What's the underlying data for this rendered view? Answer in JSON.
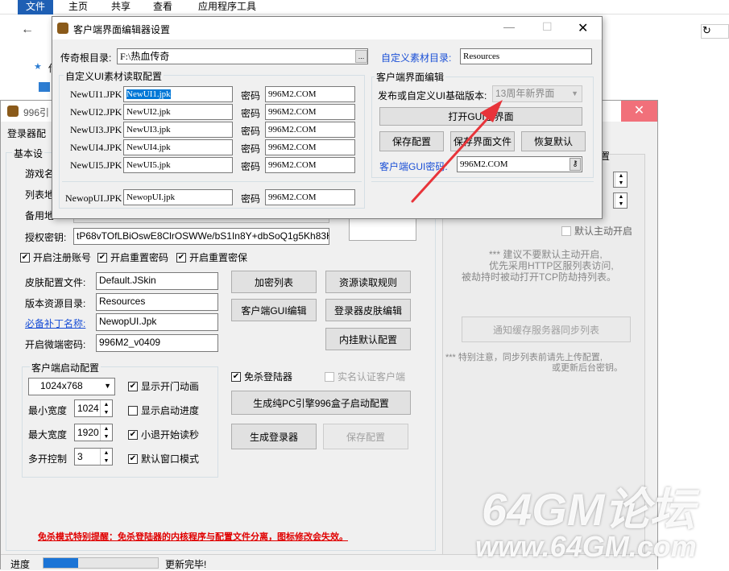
{
  "explorer": {
    "tabs": [
      "文件",
      "主页",
      "共享",
      "查看",
      "应用程序工具"
    ],
    "side_fragment": "传"
  },
  "launcher": {
    "title_fragment": "996引",
    "menu_fragment": "登录器配",
    "basic_settings": "基本设",
    "row_labels": [
      "游戏名",
      "列表地",
      "备用地"
    ],
    "auth_label": "授权密钥:",
    "auth_value": "tP68vTOfLBiOswE8ClrOSWWe/bS1In8Y+dbSoQ1g5Kh83Hsd",
    "checks": [
      "开启注册账号",
      "开启重置密码",
      "开启重置密保"
    ],
    "skin_label": "皮肤配置文件:",
    "skin_value": "Default.JSkin",
    "version_label": "版本资源目录:",
    "version_value": "Resources",
    "patch_label": "必备补丁名称:",
    "patch_value": "NewopUI.Jpk",
    "micro_label": "开启微端密码:",
    "micro_value": "996M2_v0409",
    "btn_encrypt": "加密列表",
    "btn_rules": "资源读取规则",
    "btn_gui": "客户端GUI编辑",
    "btn_skin": "登录器皮肤编辑",
    "btn_plugin": "内挂默认配置",
    "startup_group": "客户端启动配置",
    "resolution": "1024x768",
    "min_width_label": "最小宽度",
    "min_width": "1024",
    "max_width_label": "最大宽度",
    "max_width": "1920",
    "multi_label": "多开控制",
    "multi_value": "3",
    "opt_anim": "显示开门动画",
    "opt_progress": "显示启动进度",
    "opt_exit": "小退开始读秒",
    "opt_window": "默认窗口模式",
    "opt_nokill": "免杀登陆器",
    "opt_realname": "实名认证客户端",
    "btn_gen_pc": "生成纯PC引擎996盒子启动配置",
    "btn_gen": "生成登录器",
    "btn_save": "保存配置",
    "warning": "免杀模式特别提醒：免杀登陆器的内核程序与配置文件分离，图标修改会失效。",
    "right_fragment": "置",
    "right_check": "默认主动开启",
    "tip1": [
      "*** 建议不要默认主动开启,",
      "优先采用HTTP区服列表访问,",
      "被劫持时被动打开TCP防劫持列表。"
    ],
    "btn_notify": "通知缓存服务器同步列表",
    "tip2": [
      "*** 特别注意，同步列表前请先上传配置,",
      "或更新后台密钥。"
    ],
    "status_label": "进度",
    "status_text": "更新完毕!",
    "progress": 0.3
  },
  "dialog": {
    "title": "客户端界面编辑器设置",
    "root_label": "传奇根目录:",
    "root_value": "F:\\热血传奇",
    "custom_dir_label": "自定义素材目录:",
    "custom_dir_value": "Resources",
    "ui_group": "自定义UI素材读取配置",
    "pwd_label": "密码",
    "ui_rows": [
      {
        "label": "NewUI1.JPK",
        "file": "NewUI1.jpk",
        "pwd": "996M2.COM"
      },
      {
        "label": "NewUI2.JPK",
        "file": "NewUI2.jpk",
        "pwd": "996M2.COM"
      },
      {
        "label": "NewUI3.JPK",
        "file": "NewUI3.jpk",
        "pwd": "996M2.COM"
      },
      {
        "label": "NewUI4.JPK",
        "file": "NewUI4.jpk",
        "pwd": "996M2.COM"
      },
      {
        "label": "NewUI5.JPK",
        "file": "NewUI5.jpk",
        "pwd": "996M2.COM"
      }
    ],
    "newop": {
      "label": "NewopUI.JPK",
      "file": "NewopUI.jpk",
      "pwd": "996M2.COM"
    },
    "edit_group": "客户端界面编辑",
    "version_label": "发布或自定义UI基础版本:",
    "version_value": "13周年新界面",
    "btn_open": "打开GUI主界面",
    "btn_save": "保存配置",
    "btn_save_ui": "保存界面文件",
    "btn_restore": "恢复默认",
    "gui_pwd_label": "客户端GUI密码:",
    "gui_pwd_value": "996M2.COM",
    "browse_label": "..."
  },
  "watermark": {
    "line1": "64GM论坛",
    "line2": "www.64GM.com"
  },
  "colors": {
    "accent": "#2b579a",
    "link": "#0000cc",
    "warning": "#e00000",
    "arrow": "#e8343a",
    "progress": "#1b74d6"
  }
}
